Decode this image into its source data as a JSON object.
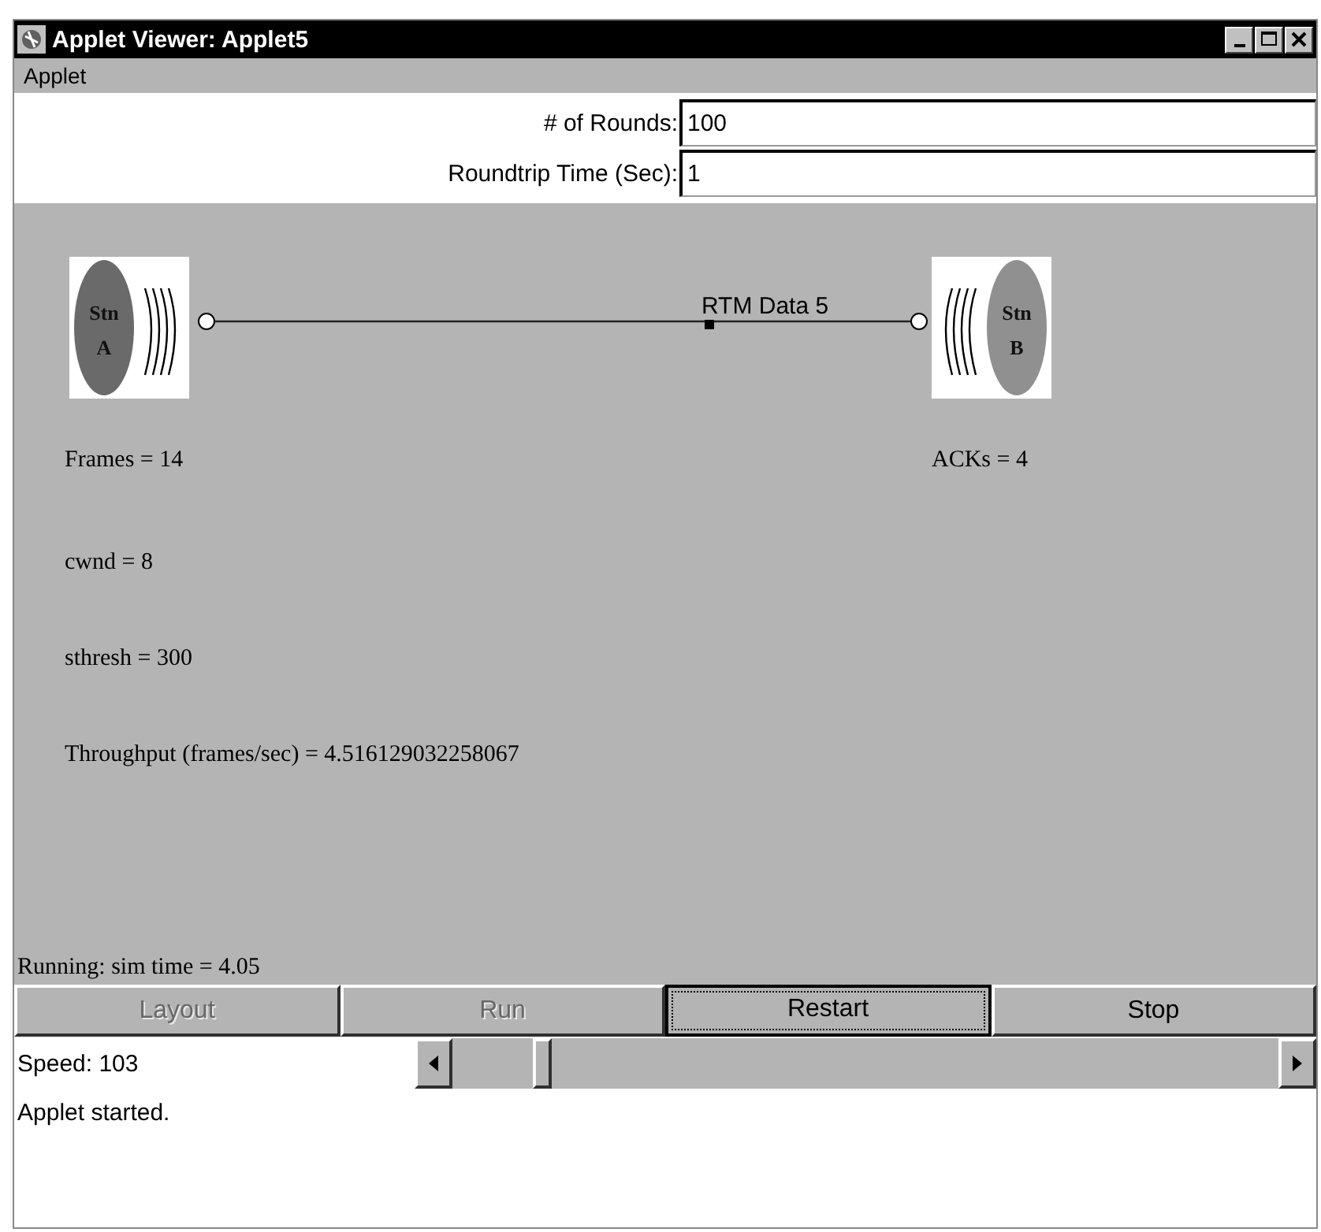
{
  "window": {
    "title": "Applet Viewer: Applet5"
  },
  "menu": [
    "Applet"
  ],
  "fields": [
    {
      "label": "# of Rounds:",
      "value": "100"
    },
    {
      "label": "Roundtrip Time (Sec):",
      "value": "1"
    }
  ],
  "simulation": {
    "stations": [
      {
        "line1": "Stn",
        "line2": "A"
      },
      {
        "line1": "Stn",
        "line2": "B"
      }
    ],
    "packet_label": "RTM Data 5",
    "frames": "Frames = 14",
    "acks": "ACKs = 4",
    "stats": [
      "cwnd = 8",
      "sthresh = 300",
      "Throughput (frames/sec) = 4.516129032258067"
    ],
    "status": "Running: sim time = 4.05"
  },
  "buttons": [
    {
      "label": "Layout",
      "disabled": true,
      "focused": false
    },
    {
      "label": "Run",
      "disabled": true,
      "focused": false
    },
    {
      "label": "Restart",
      "disabled": false,
      "focused": true
    },
    {
      "label": "Stop",
      "disabled": false,
      "focused": false
    }
  ],
  "speed": {
    "label": "Speed: 103",
    "level": 0.1
  },
  "status_bar": "Applet started."
}
